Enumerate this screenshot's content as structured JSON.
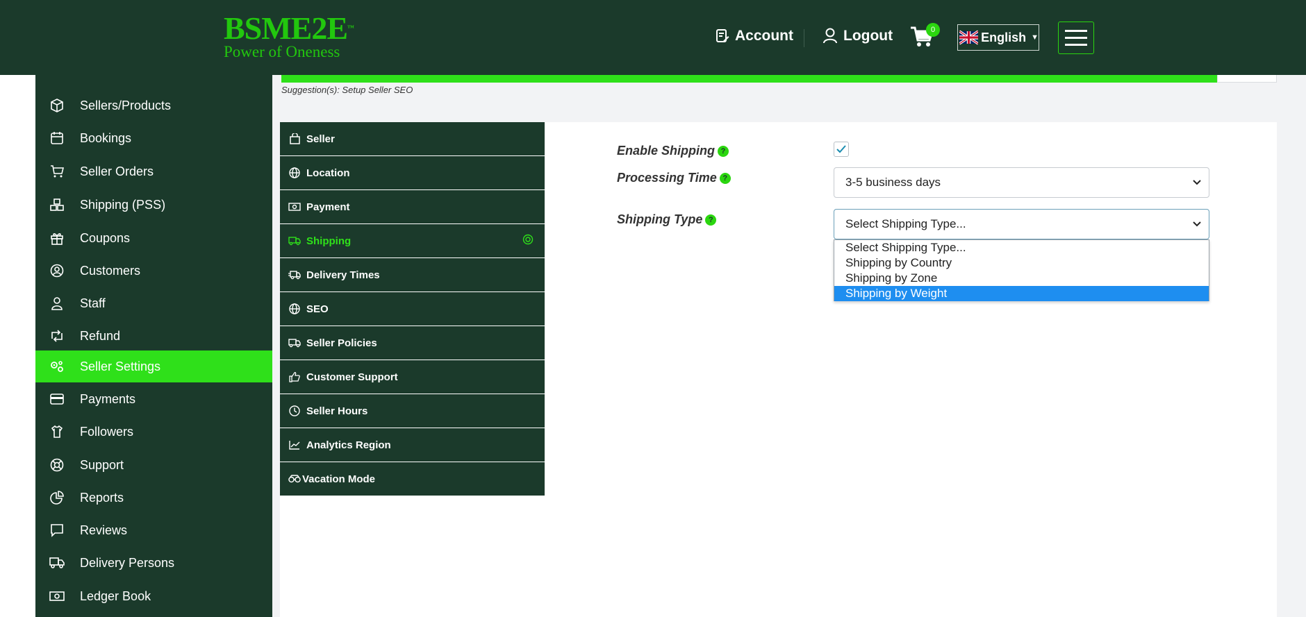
{
  "header": {
    "logo_main": "BSME2E",
    "logo_tm": "™",
    "logo_tagline": "Power of Oneness",
    "account_label": "Account",
    "logout_label": "Logout",
    "cart_count": "0",
    "language": "English",
    "accent_color": "#2fe01a",
    "header_bg": "#1b3a2b"
  },
  "sidebar": {
    "items": [
      {
        "label": "Sellers/Products",
        "icon": "box-icon"
      },
      {
        "label": "Bookings",
        "icon": "calendar-icon"
      },
      {
        "label": "Seller Orders",
        "icon": "cart-icon"
      },
      {
        "label": "Shipping (PSS)",
        "icon": "boxes-icon"
      },
      {
        "label": "Coupons",
        "icon": "gift-icon"
      },
      {
        "label": "Customers",
        "icon": "user-circle-icon"
      },
      {
        "label": "Staff",
        "icon": "user-icon"
      },
      {
        "label": "Refund",
        "icon": "retweet-icon"
      },
      {
        "label": "Seller Settings",
        "icon": "cogs-icon",
        "active": true
      },
      {
        "label": "Payments",
        "icon": "credit-card-icon"
      },
      {
        "label": "Followers",
        "icon": "shirt-icon"
      },
      {
        "label": "Support",
        "icon": "life-ring-icon"
      },
      {
        "label": "Reports",
        "icon": "pie-chart-icon"
      },
      {
        "label": "Reviews",
        "icon": "comment-icon"
      },
      {
        "label": "Delivery Persons",
        "icon": "truck-icon"
      },
      {
        "label": "Ledger Book",
        "icon": "money-icon"
      }
    ]
  },
  "main": {
    "suggestion": "Suggestion(s): Setup Seller SEO",
    "tabs": [
      {
        "label": "Seller",
        "icon": "shopping-bag-icon"
      },
      {
        "label": "Location",
        "icon": "globe-icon"
      },
      {
        "label": "Payment",
        "icon": "money-icon"
      },
      {
        "label": "Shipping",
        "icon": "truck-icon",
        "active": true
      },
      {
        "label": "Delivery Times",
        "icon": "truck-fast-icon"
      },
      {
        "label": "SEO",
        "icon": "globe-icon"
      },
      {
        "label": "Seller Policies",
        "icon": "truck-icon"
      },
      {
        "label": "Customer Support",
        "icon": "thumbs-up-icon"
      },
      {
        "label": "Seller Hours",
        "icon": "clock-icon"
      },
      {
        "label": "Analytics Region",
        "icon": "line-chart-icon"
      },
      {
        "label": "Vacation Mode",
        "icon": "binoculars-icon"
      }
    ],
    "form": {
      "enable_shipping_label": "Enable Shipping",
      "enable_shipping_checked": true,
      "processing_time_label": "Processing Time",
      "processing_time_value": "3-5 business days",
      "shipping_type_label": "Shipping Type",
      "shipping_type_value": "Select Shipping Type...",
      "help_glyph": "?",
      "shipping_type_options": [
        "Select Shipping Type...",
        "Shipping by Country",
        "Shipping by Zone",
        "Shipping by Weight"
      ],
      "highlighted_option": "Shipping by Weight"
    }
  }
}
